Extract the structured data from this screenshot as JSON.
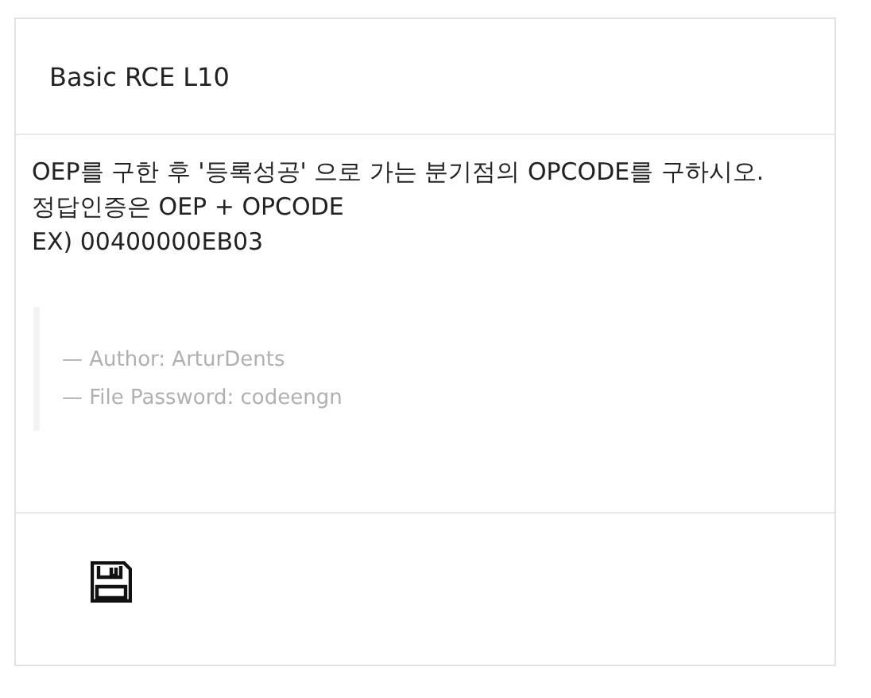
{
  "card": {
    "title": "Basic RCE L10",
    "description": [
      "OEP를 구한 후 '등록성공' 으로 가는 분기점의 OPCODE를 구하시오.",
      "정답인증은 OEP + OPCODE",
      "EX) 00400000EB03"
    ],
    "quote": [
      "— Author: ArturDents",
      "— File Password: codeengn"
    ]
  }
}
